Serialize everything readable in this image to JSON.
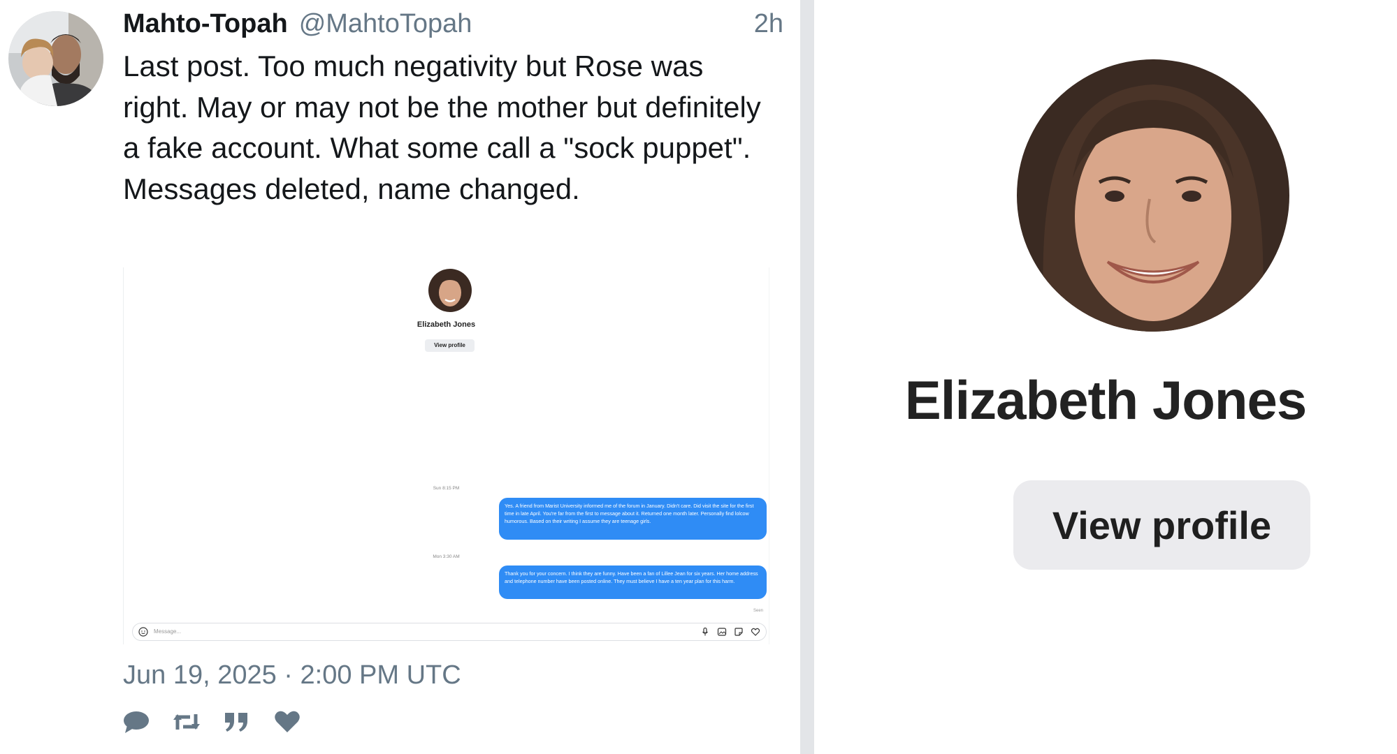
{
  "tweet": {
    "display_name": "Mahto-Topah",
    "handle": "@MahtoTopah",
    "relative_time": "2h",
    "text": "Last post. Too much negativity but Rose was right. May or may not be the mother but definitely a fake account. What some call a \"sock puppet\". Messages deleted, name changed.",
    "date": "Jun 19, 2025 · 2:00 PM UTC",
    "actions": [
      {
        "icon": "reply-icon"
      },
      {
        "icon": "retweet-icon"
      },
      {
        "icon": "quote-icon"
      },
      {
        "icon": "like-icon"
      }
    ]
  },
  "embedded_chat": {
    "name": "Elizabeth Jones",
    "view_profile": "View profile",
    "time_1": "Sun 8:15 PM",
    "message_1": "Yes. A friend from Marist University informed me of the forum in January. Didn't care. Did visit the site for the first time in late April. You're far from the first to message about it. Returned one month later. Personally find lolcow humorous. Based on their writing I assume they are teenage girls.",
    "time_2": "Mon 3:30 AM",
    "message_2": "Thank you for your concern. I think they are funny. Have been a fan of Lillee Jean for six years. Her home address and telephone number have been posted online. They must believe I have a ten year plan for this harm.",
    "seen": "Seen",
    "input_placeholder": "Message...",
    "bubble_color": "#2f8cf5"
  },
  "profile_zoom": {
    "name": "Elizabeth Jones",
    "view_profile": "View profile"
  }
}
